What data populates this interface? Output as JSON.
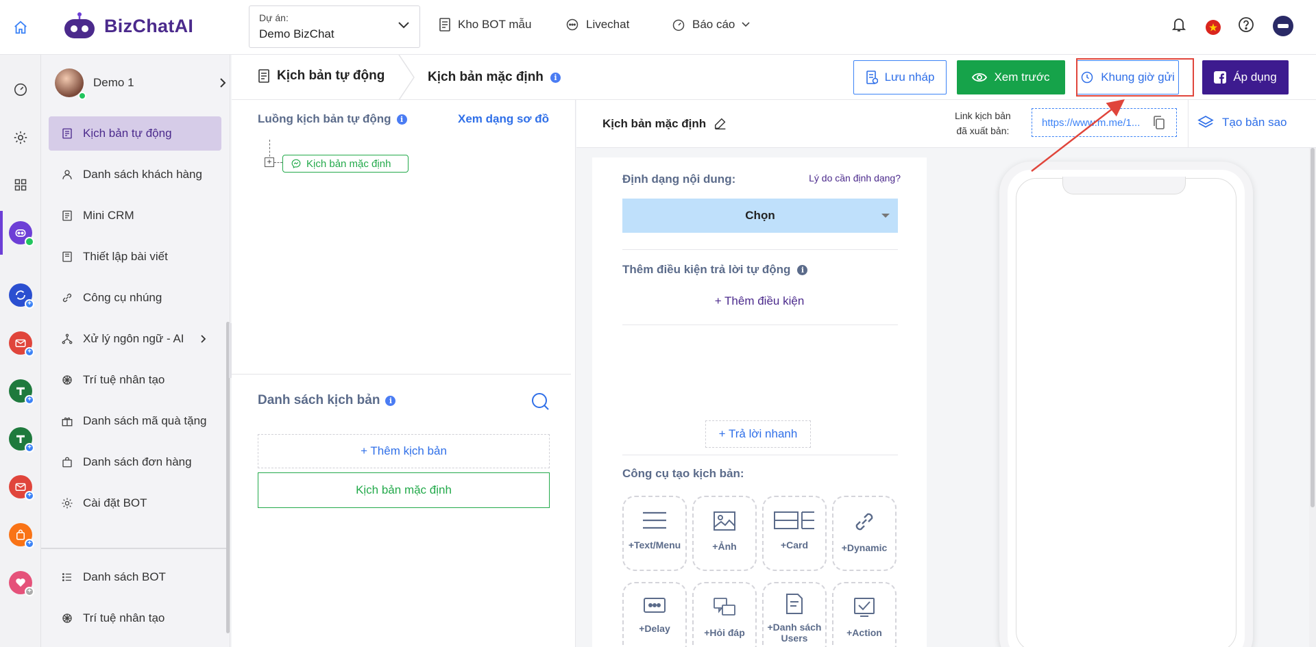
{
  "brand": {
    "name": "BizChatAI",
    "accent": "#4b2a8c"
  },
  "project": {
    "label": "Dự án:",
    "value": "Demo BizChat"
  },
  "topnav": [
    {
      "label": "Kho BOT mẫu",
      "icon": "template-icon"
    },
    {
      "label": "Livechat",
      "icon": "chat-bubble-icon"
    },
    {
      "label": "Báo cáo",
      "icon": "dashboard-icon"
    }
  ],
  "user": {
    "name": "Demo 1",
    "status": "online"
  },
  "sidebar": {
    "items": [
      {
        "label": "Kịch bản tự động",
        "icon": "script-icon",
        "active": true
      },
      {
        "label": "Danh sách khách hàng",
        "icon": "user-icon"
      },
      {
        "label": "Mini CRM",
        "icon": "crm-icon"
      },
      {
        "label": "Thiết lập bài viết",
        "icon": "post-icon"
      },
      {
        "label": "Công cụ nhúng",
        "icon": "link-icon"
      },
      {
        "label": "Xử lý ngôn ngữ - AI",
        "icon": "nlp-icon"
      },
      {
        "label": "Trí tuệ nhân tạo",
        "icon": "ai-icon"
      },
      {
        "label": "Danh sách mã quà tặng",
        "icon": "gift-icon"
      },
      {
        "label": "Danh sách đơn hàng",
        "icon": "bag-icon"
      },
      {
        "label": "Cài đặt BOT",
        "icon": "gear-icon"
      }
    ],
    "bottom": [
      {
        "label": "Danh sách BOT",
        "icon": "list-icon"
      },
      {
        "label": "Trí tuệ nhân tạo",
        "icon": "ai-icon"
      }
    ]
  },
  "header": {
    "crumb1": "Kịch bản tự động",
    "crumb2": "Kịch bản mặc định",
    "info": "i",
    "buttons": {
      "draft": "Lưu nháp",
      "preview": "Xem trước",
      "schedule": "Khung giờ gửi",
      "apply": "Áp dụng"
    }
  },
  "flow": {
    "title": "Luồng kịch bản tự động",
    "diagram_link": "Xem dạng sơ đồ",
    "expander": "+",
    "node": "Kịch bản mặc định",
    "list_title": "Danh sách kịch bản",
    "add_script": "+ Thêm kịch bản",
    "scripts": [
      "Kịch bản mặc định"
    ]
  },
  "editor": {
    "title": "Kịch bản mặc định",
    "link_label_1": "Link kịch bản",
    "link_label_2": "đã xuất bản:",
    "link_url": "https://www.m.me/1...",
    "copy_button": "Tạo bản sao",
    "format_label": "Định dạng nội dung:",
    "format_why": "Lý do cần định dạng?",
    "format_select": "Chọn",
    "condition_label": "Thêm điều kiện trả lời tự động",
    "condition_add": "+ Thêm điều kiện",
    "quick_reply": "+ Trả lời nhanh",
    "tools_label": "Công cụ tạo kịch bản:",
    "tools": [
      {
        "label": "+Text/Menu",
        "icon": "menu-lines-icon"
      },
      {
        "label": "+Ảnh",
        "icon": "image-icon"
      },
      {
        "label": "+Card",
        "icon": "card-icon"
      },
      {
        "label": "+Dynamic",
        "icon": "dynamic-link-icon"
      },
      {
        "label": "+Delay",
        "icon": "delay-icon"
      },
      {
        "label": "+Hỏi đáp",
        "icon": "qa-icon"
      },
      {
        "label": "+Danh sách Users",
        "icon": "user-list-icon"
      },
      {
        "label": "+Action",
        "icon": "action-check-icon"
      }
    ]
  },
  "colors": {
    "primary_blue": "#2f6fe8",
    "green": "#16a34a",
    "apply_purple": "#3d1b8f",
    "highlight_red": "#e0453b",
    "select_bg": "#bfe0fb"
  }
}
